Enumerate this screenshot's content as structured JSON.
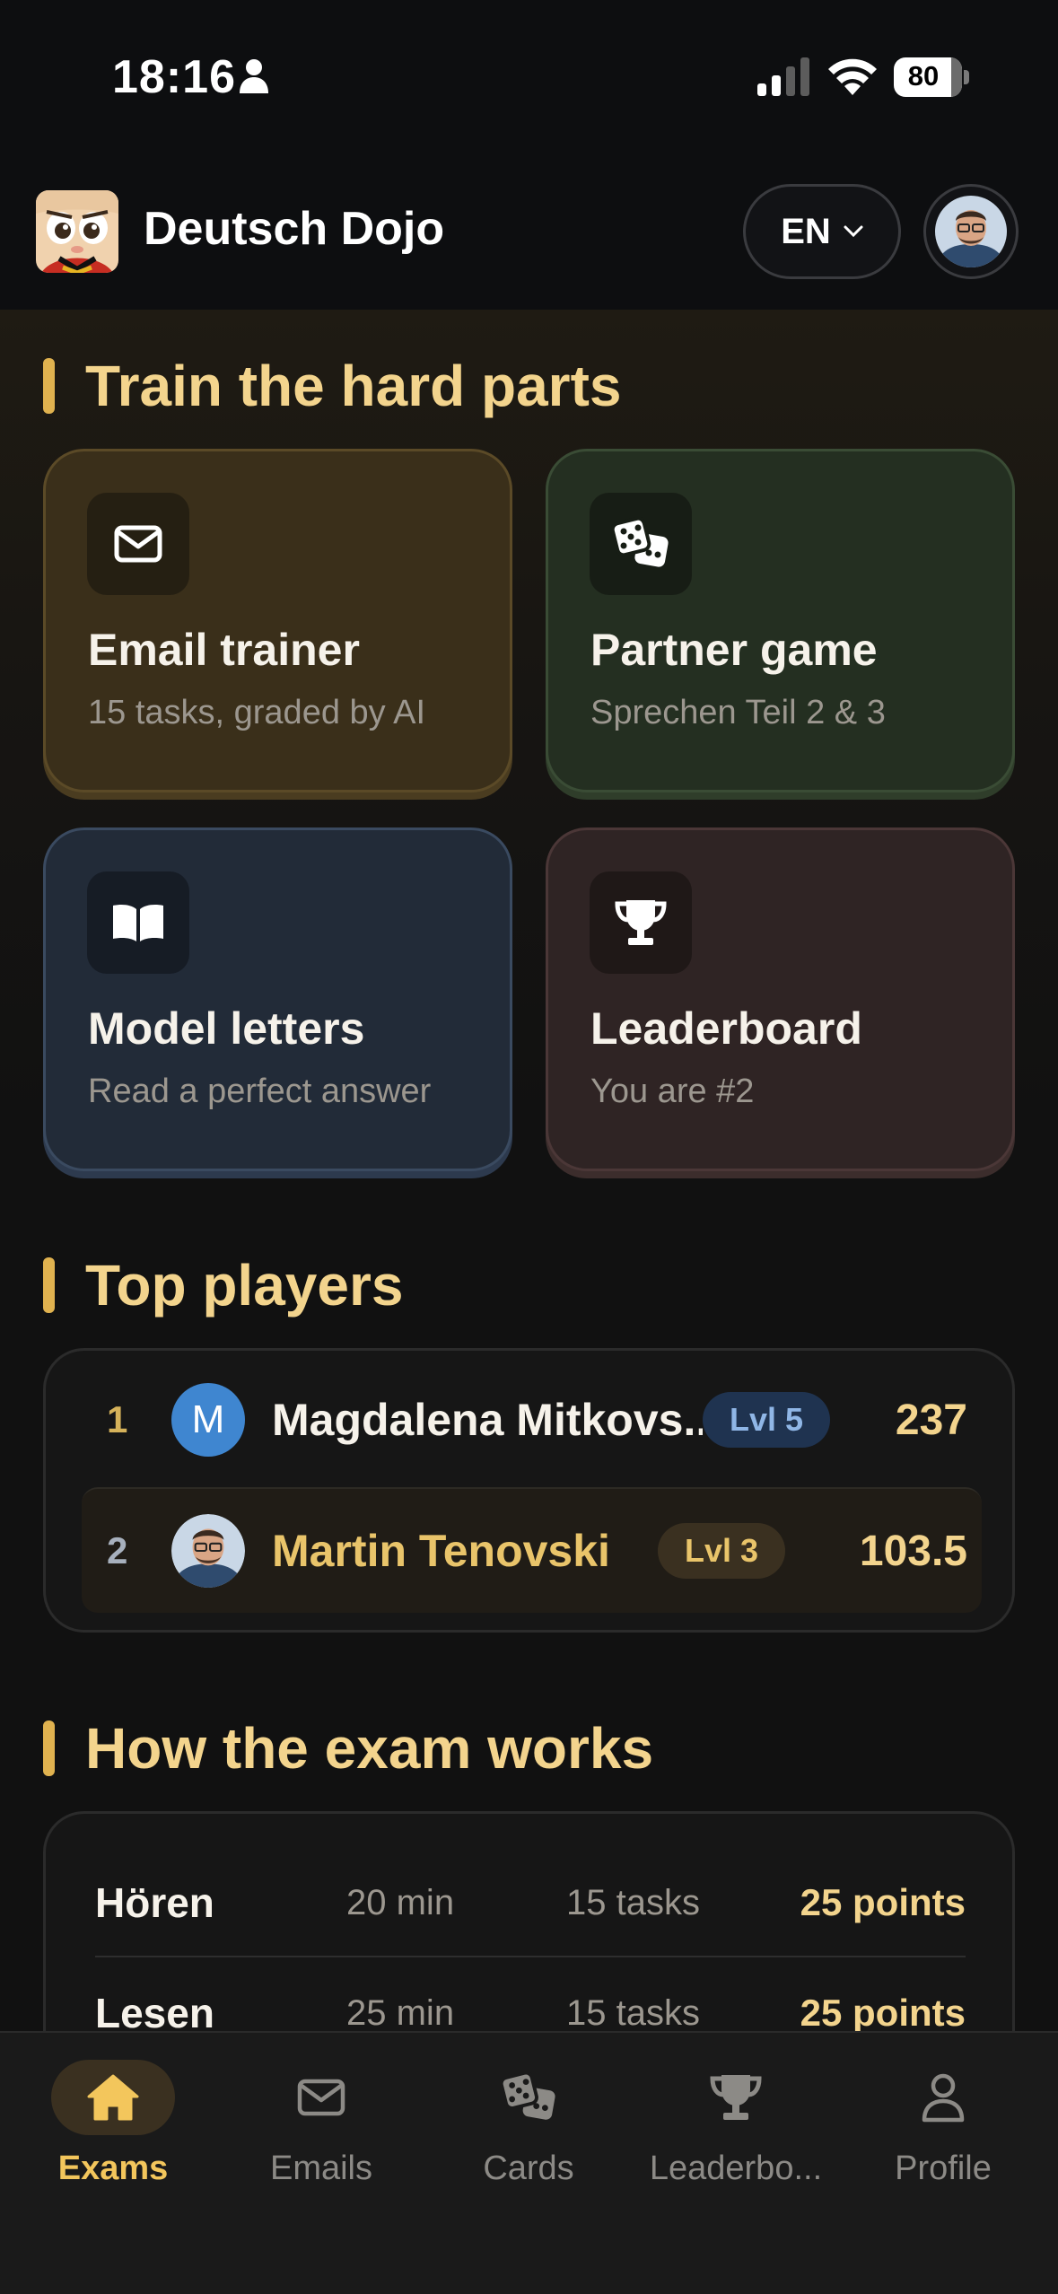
{
  "status_bar": {
    "time": "18:16",
    "battery": "80"
  },
  "header": {
    "app_title": "Deutsch Dojo",
    "language": "EN"
  },
  "train": {
    "title": "Train the hard parts",
    "cards": [
      {
        "title": "Email trainer",
        "subtitle": "15 tasks, graded by AI",
        "icon": "mail-icon"
      },
      {
        "title": "Partner game",
        "subtitle": "Sprechen Teil 2 & 3",
        "icon": "dice-icon"
      },
      {
        "title": "Model letters",
        "subtitle": "Read a perfect answer",
        "icon": "book-icon"
      },
      {
        "title": "Leaderboard",
        "subtitle": "You are #2",
        "icon": "trophy-icon"
      }
    ]
  },
  "top_players": {
    "title": "Top players",
    "rows": [
      {
        "rank": "1",
        "avatar_letter": "M",
        "name": "Magdalena Mitkovs...",
        "level": "Lvl 5",
        "points": "237"
      },
      {
        "rank": "2",
        "name": "Martin Tenovski",
        "level": "Lvl 3",
        "points": "103.5"
      }
    ]
  },
  "exam": {
    "title": "How the exam works",
    "rows": [
      {
        "part": "Hören",
        "duration": "20 min",
        "tasks": "15 tasks",
        "points": "25 points"
      },
      {
        "part": "Lesen",
        "duration": "25 min",
        "tasks": "15 tasks",
        "points": "25 points"
      }
    ]
  },
  "nav": [
    {
      "label": "Exams",
      "icon": "home-icon",
      "active": true
    },
    {
      "label": "Emails",
      "icon": "mail-icon"
    },
    {
      "label": "Cards",
      "icon": "dice-icon"
    },
    {
      "label": "Leaderbo...",
      "icon": "trophy-icon"
    },
    {
      "label": "Profile",
      "icon": "person-icon"
    }
  ],
  "colors": {
    "accent_gold": "#f3d48d",
    "accent_bar": "#e0b24f",
    "level_blue_bg": "#1f3350",
    "level_gold_bg": "#3a3020",
    "avatar_blue": "#3f86d0"
  }
}
